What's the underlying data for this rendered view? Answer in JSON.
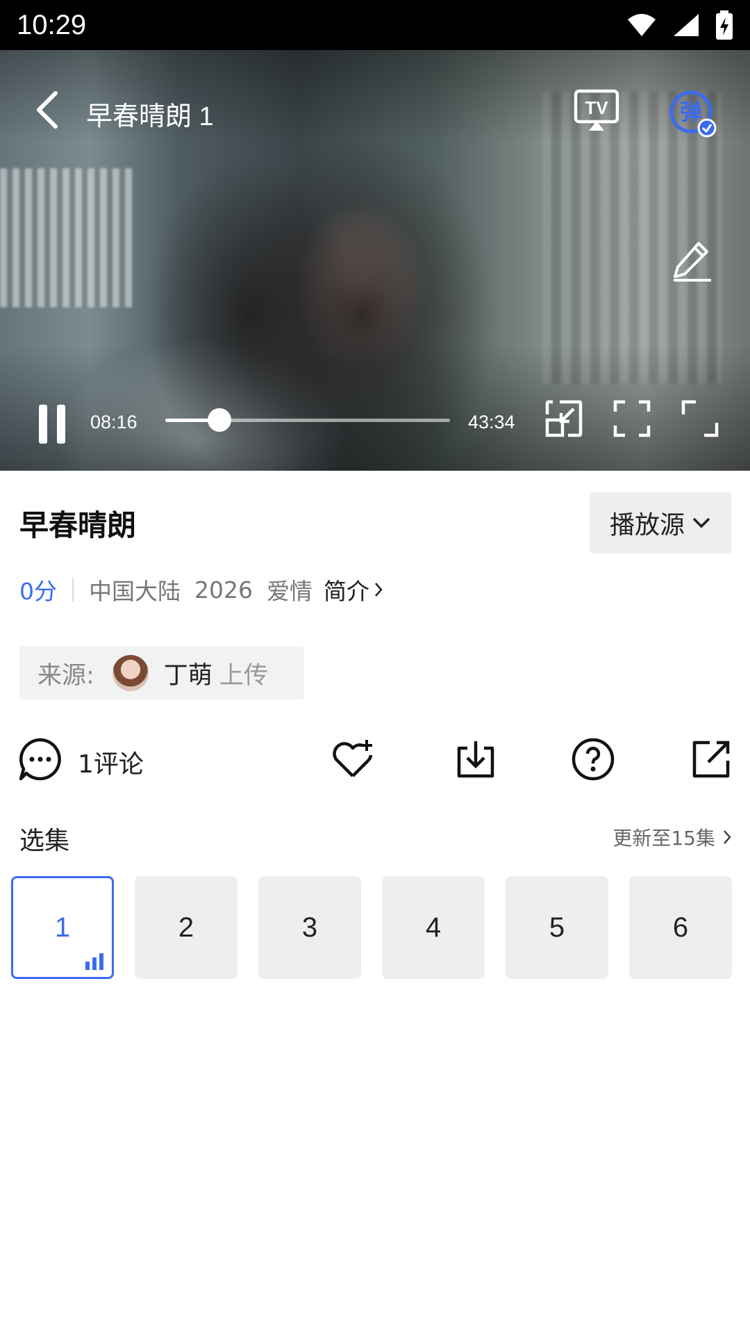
{
  "status_bar": {
    "time": "10:29"
  },
  "player": {
    "title": "早春晴朗 1",
    "current_time": "08:16",
    "duration": "43:34",
    "progress": 0.19,
    "danmu_label": "弹",
    "tv_label": "TV"
  },
  "info": {
    "title": "早春晴朗",
    "source_button": "播放源",
    "score": "0分",
    "region": "中国大陆",
    "year": "2026",
    "genre": "爱情",
    "intro_link": "简介"
  },
  "uploader": {
    "label": "来源:",
    "name": "丁萌",
    "suffix": "上传"
  },
  "actions": {
    "comment_count": "1评论"
  },
  "episodes": {
    "label": "选集",
    "update_text": "更新至15集",
    "items": [
      "1",
      "2",
      "3",
      "4",
      "5",
      "6"
    ],
    "active_index": 0
  },
  "colors": {
    "accent": "#3b6bf0"
  }
}
